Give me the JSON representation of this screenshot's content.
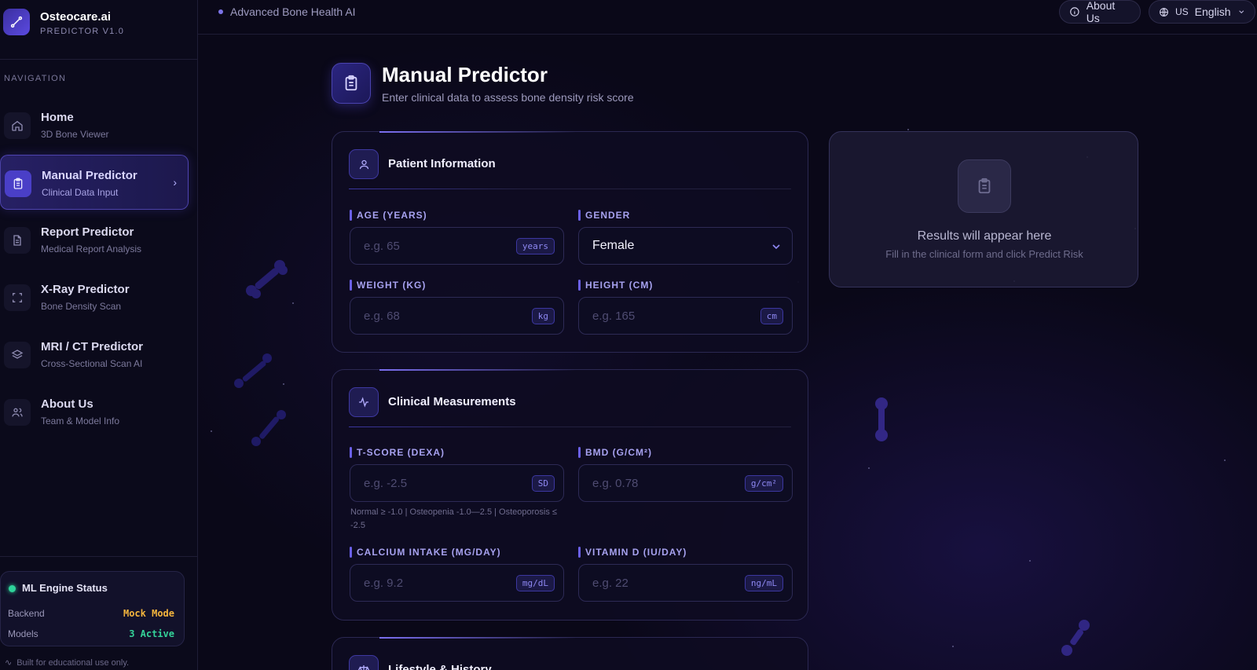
{
  "brand": {
    "name": "Osteocare.ai",
    "version": "PREDICTOR V1.0"
  },
  "topbar": {
    "tagline": "Advanced Bone Health AI",
    "about_label": "About Us",
    "lang_code": "US",
    "lang_label": "English"
  },
  "sidebar": {
    "heading": "NAVIGATION",
    "items": [
      {
        "title": "Home",
        "sub": "3D Bone Viewer",
        "icon": "home-icon"
      },
      {
        "title": "Manual Predictor",
        "sub": "Clinical Data Input",
        "icon": "clipboard-icon",
        "active": true
      },
      {
        "title": "Report Predictor",
        "sub": "Medical Report Analysis",
        "icon": "document-icon"
      },
      {
        "title": "X-Ray Predictor",
        "sub": "Bone Density Scan",
        "icon": "scan-icon"
      },
      {
        "title": "MRI / CT Predictor",
        "sub": "Cross-Sectional Scan AI",
        "icon": "layers-icon"
      },
      {
        "title": "About Us",
        "sub": "Team & Model Info",
        "icon": "users-icon"
      }
    ],
    "status": {
      "title": "ML Engine Status",
      "rows": [
        {
          "label": "Backend",
          "value": "Mock Mode",
          "color": "#f5b53d"
        },
        {
          "label": "Models",
          "value": "3 Active",
          "color": "#34d399"
        }
      ]
    },
    "footer": "Built for educational use only."
  },
  "page": {
    "title": "Manual Predictor",
    "subtitle": "Enter clinical data to assess bone density risk score"
  },
  "patient": {
    "title": "Patient Information",
    "age": {
      "label": "AGE (YEARS)",
      "placeholder": "e.g. 65",
      "unit": "years"
    },
    "gender": {
      "label": "GENDER",
      "value": "Female"
    },
    "weight": {
      "label": "WEIGHT (KG)",
      "placeholder": "e.g. 68",
      "unit": "kg"
    },
    "height": {
      "label": "HEIGHT (CM)",
      "placeholder": "e.g. 165",
      "unit": "cm"
    }
  },
  "clinical": {
    "title": "Clinical Measurements",
    "tscore": {
      "label": "T-SCORE (DEXA)",
      "placeholder": "e.g. -2.5",
      "unit": "SD",
      "hint": "Normal ≥ -1.0 | Osteopenia -1.0—2.5 | Osteoporosis ≤ -2.5"
    },
    "bmd": {
      "label": "BMD (G/CM²)",
      "placeholder": "e.g. 0.78",
      "unit": "g/cm²"
    },
    "calcium": {
      "label": "CALCIUM INTAKE (MG/DAY)",
      "placeholder": "e.g. 9.2",
      "unit": "mg/dL"
    },
    "vitd": {
      "label": "VITAMIN D (IU/DAY)",
      "placeholder": "e.g. 22",
      "unit": "ng/mL"
    }
  },
  "lifestyle": {
    "title": "Lifestyle & History"
  },
  "results": {
    "title": "Results will appear here",
    "subtitle": "Fill in the clinical form and click Predict Risk"
  },
  "colors": {
    "accent": "#6b60e8",
    "background": "#0a0818",
    "status_ok": "#2ed39a"
  }
}
